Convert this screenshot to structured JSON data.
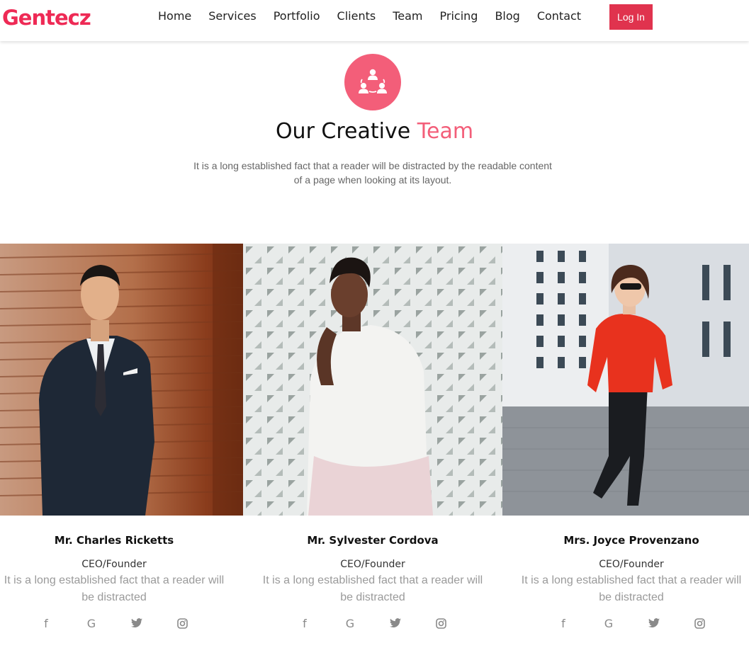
{
  "nav": {
    "logo": "Gentecz",
    "links": [
      "Home",
      "Services",
      "Portfolio",
      "Clients",
      "Team",
      "Pricing",
      "Blog",
      "Contact"
    ],
    "login_label": "Log In"
  },
  "section": {
    "icon": "team-icon",
    "title_main": "Our Creative",
    "title_accent": "Team",
    "description": "It is a long established fact that a reader will be distracted by the readable content of a page when looking at its layout."
  },
  "team": [
    {
      "name": "Mr. Charles Ricketts",
      "role": "CEO/Founder",
      "bio": "It is a long established fact that a reader will be distracted",
      "socials": [
        "facebook-icon",
        "google-icon",
        "twitter-icon",
        "instagram-icon"
      ]
    },
    {
      "name": "Mr. Sylvester Cordova",
      "role": "CEO/Founder",
      "bio": "It is a long established fact that a reader will be distracted",
      "socials": [
        "facebook-icon",
        "google-icon",
        "twitter-icon",
        "instagram-icon"
      ]
    },
    {
      "name": "Mrs. Joyce Provenzano",
      "role": "CEO/Founder",
      "bio": "It is a long established fact that a reader will be distracted",
      "socials": [
        "facebook-icon",
        "google-icon",
        "twitter-icon",
        "instagram-icon"
      ]
    }
  ],
  "colors": {
    "brand": "#ee2a55",
    "accent": "#f35e79",
    "button": "#e0334e",
    "muted_text": "#9a9a9a"
  }
}
